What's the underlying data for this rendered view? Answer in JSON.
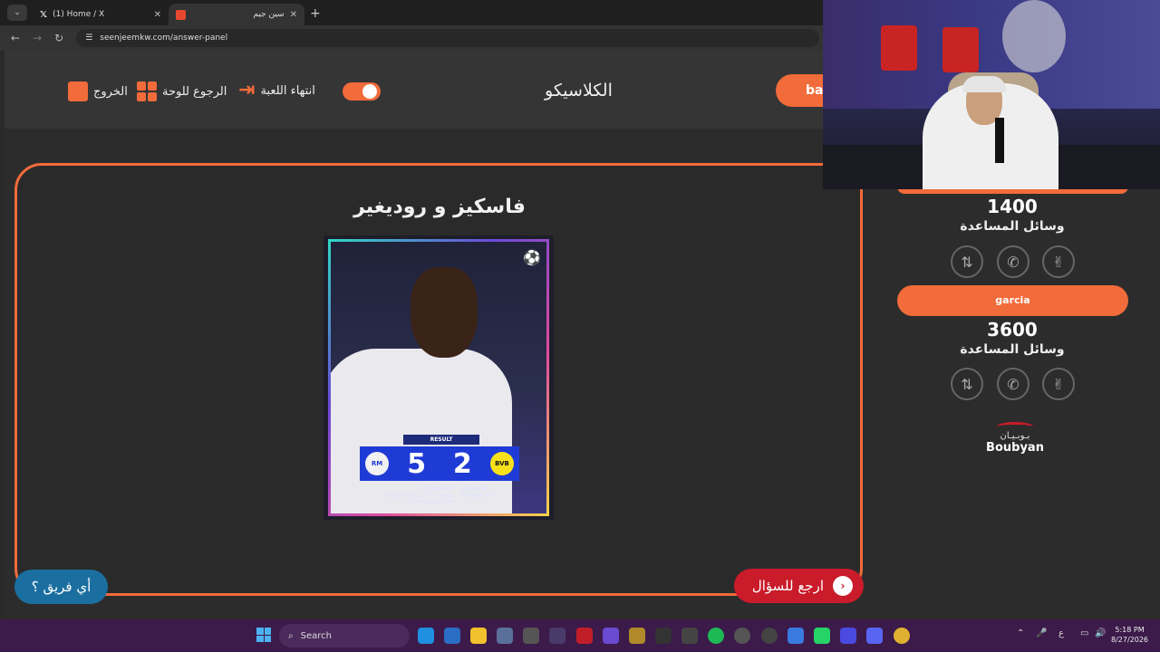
{
  "browser": {
    "tabs": [
      {
        "title": "(1) Home / X",
        "active": false
      },
      {
        "title": "سين جيم",
        "active": true
      }
    ],
    "url": "seenjeemkw.com/answer-panel"
  },
  "topbar": {
    "exit_label": "الخروج",
    "back_to_board_label": "الرجوع للوحة",
    "end_game_label": "انتهاء اللعبة",
    "game_title": "الكلاسيكو",
    "team1_pill": "ba"
  },
  "question": {
    "answer_title": "فاسكيز و روديغير",
    "image": {
      "result_label": "RESULT",
      "home_score": "5",
      "away_score": "2",
      "home_crest": "RM",
      "away_crest": "BVB",
      "scorers_left": "RÜDIGER 60'\nVINÍCIUS JR. 62', 86', 90'+3\nLUCAS VÁZQUEZ 83'",
      "scorers_right": "MALEN 30'\nGITTENS 34'"
    }
  },
  "buttons": {
    "back_to_question": "ارجع للسؤال",
    "which_team": "أي فريق ؟"
  },
  "scoreboard": {
    "team1": {
      "points": "1400",
      "aids_label": "وسائل المساعدة"
    },
    "team2": {
      "name": "garcia",
      "points": "3600",
      "aids_label": "وسائل المساعدة"
    }
  },
  "sponsor": {
    "arabic": "بـوبـيـان",
    "english": "Boubyan"
  },
  "taskbar": {
    "search_placeholder": "Search",
    "time": "5:18 PM",
    "date": "8/27/2026",
    "lang": "ع"
  },
  "colors": {
    "accent": "#f26b3a",
    "back_button": "#c91b2a",
    "which_button": "#1a6fa0"
  }
}
